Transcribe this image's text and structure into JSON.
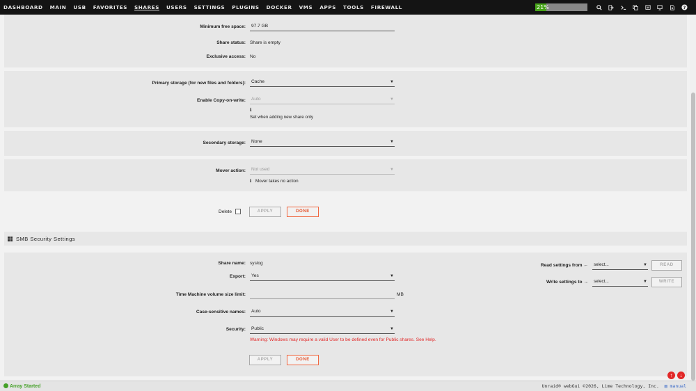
{
  "nav": {
    "items": [
      "DASHBOARD",
      "MAIN",
      "USB",
      "FAVORITES",
      "SHARES",
      "USERS",
      "SETTINGS",
      "PLUGINS",
      "DOCKER",
      "VMS",
      "APPS",
      "TOOLS",
      "FIREWALL"
    ],
    "active": "SHARES",
    "cpu_label": "21%",
    "cpu_percent": 21,
    "icons": [
      "search-icon",
      "logout-icon",
      "terminal-icon",
      "feedback-icon",
      "notes-icon",
      "monitor-icon",
      "docs-icon",
      "help-icon"
    ]
  },
  "share": {
    "min_free_label": "Minimum free space:",
    "min_free_value": "97.7 GB",
    "status_label": "Share status:",
    "status_value": "Share is empty",
    "exclusive_label": "Exclusive access:",
    "exclusive_value": "No"
  },
  "primary": {
    "label": "Primary storage (for new files and folders):",
    "value": "Cache",
    "cow_label": "Enable Copy-on-write:",
    "cow_value": "Auto",
    "cow_note": "Set when adding new share only"
  },
  "secondary": {
    "label": "Secondary storage:",
    "value": "None"
  },
  "mover": {
    "label": "Mover action:",
    "value": "Not used",
    "note": "Mover takes no action"
  },
  "actions": {
    "delete_label": "Delete",
    "apply_label": "APPLY",
    "done_label": "DONE"
  },
  "smb": {
    "title": "SMB Security Settings",
    "share_name_label": "Share name:",
    "share_name_value": "syslog",
    "export_label": "Export:",
    "export_value": "Yes",
    "tm_label": "Time Machine volume size limit:",
    "tm_value": "",
    "tm_unit": "MB",
    "case_label": "Case-sensitive names:",
    "case_value": "Auto",
    "security_label": "Security:",
    "security_value": "Public",
    "warning": "Warning: Windows may require a valid User to be defined even for Public shares. See Help.",
    "read_from_label": "Read settings from",
    "read_from_select": "select...",
    "read_button": "READ",
    "write_to_label": "Write settings to",
    "write_to_select": "select...",
    "write_button": "WRITE",
    "apply_label": "APPLY",
    "done_label": "DONE"
  },
  "footer": {
    "status": "Array Started",
    "copyright": "Unraid® webGui ©2026, Lime Technology, Inc.",
    "manual": "manual"
  }
}
